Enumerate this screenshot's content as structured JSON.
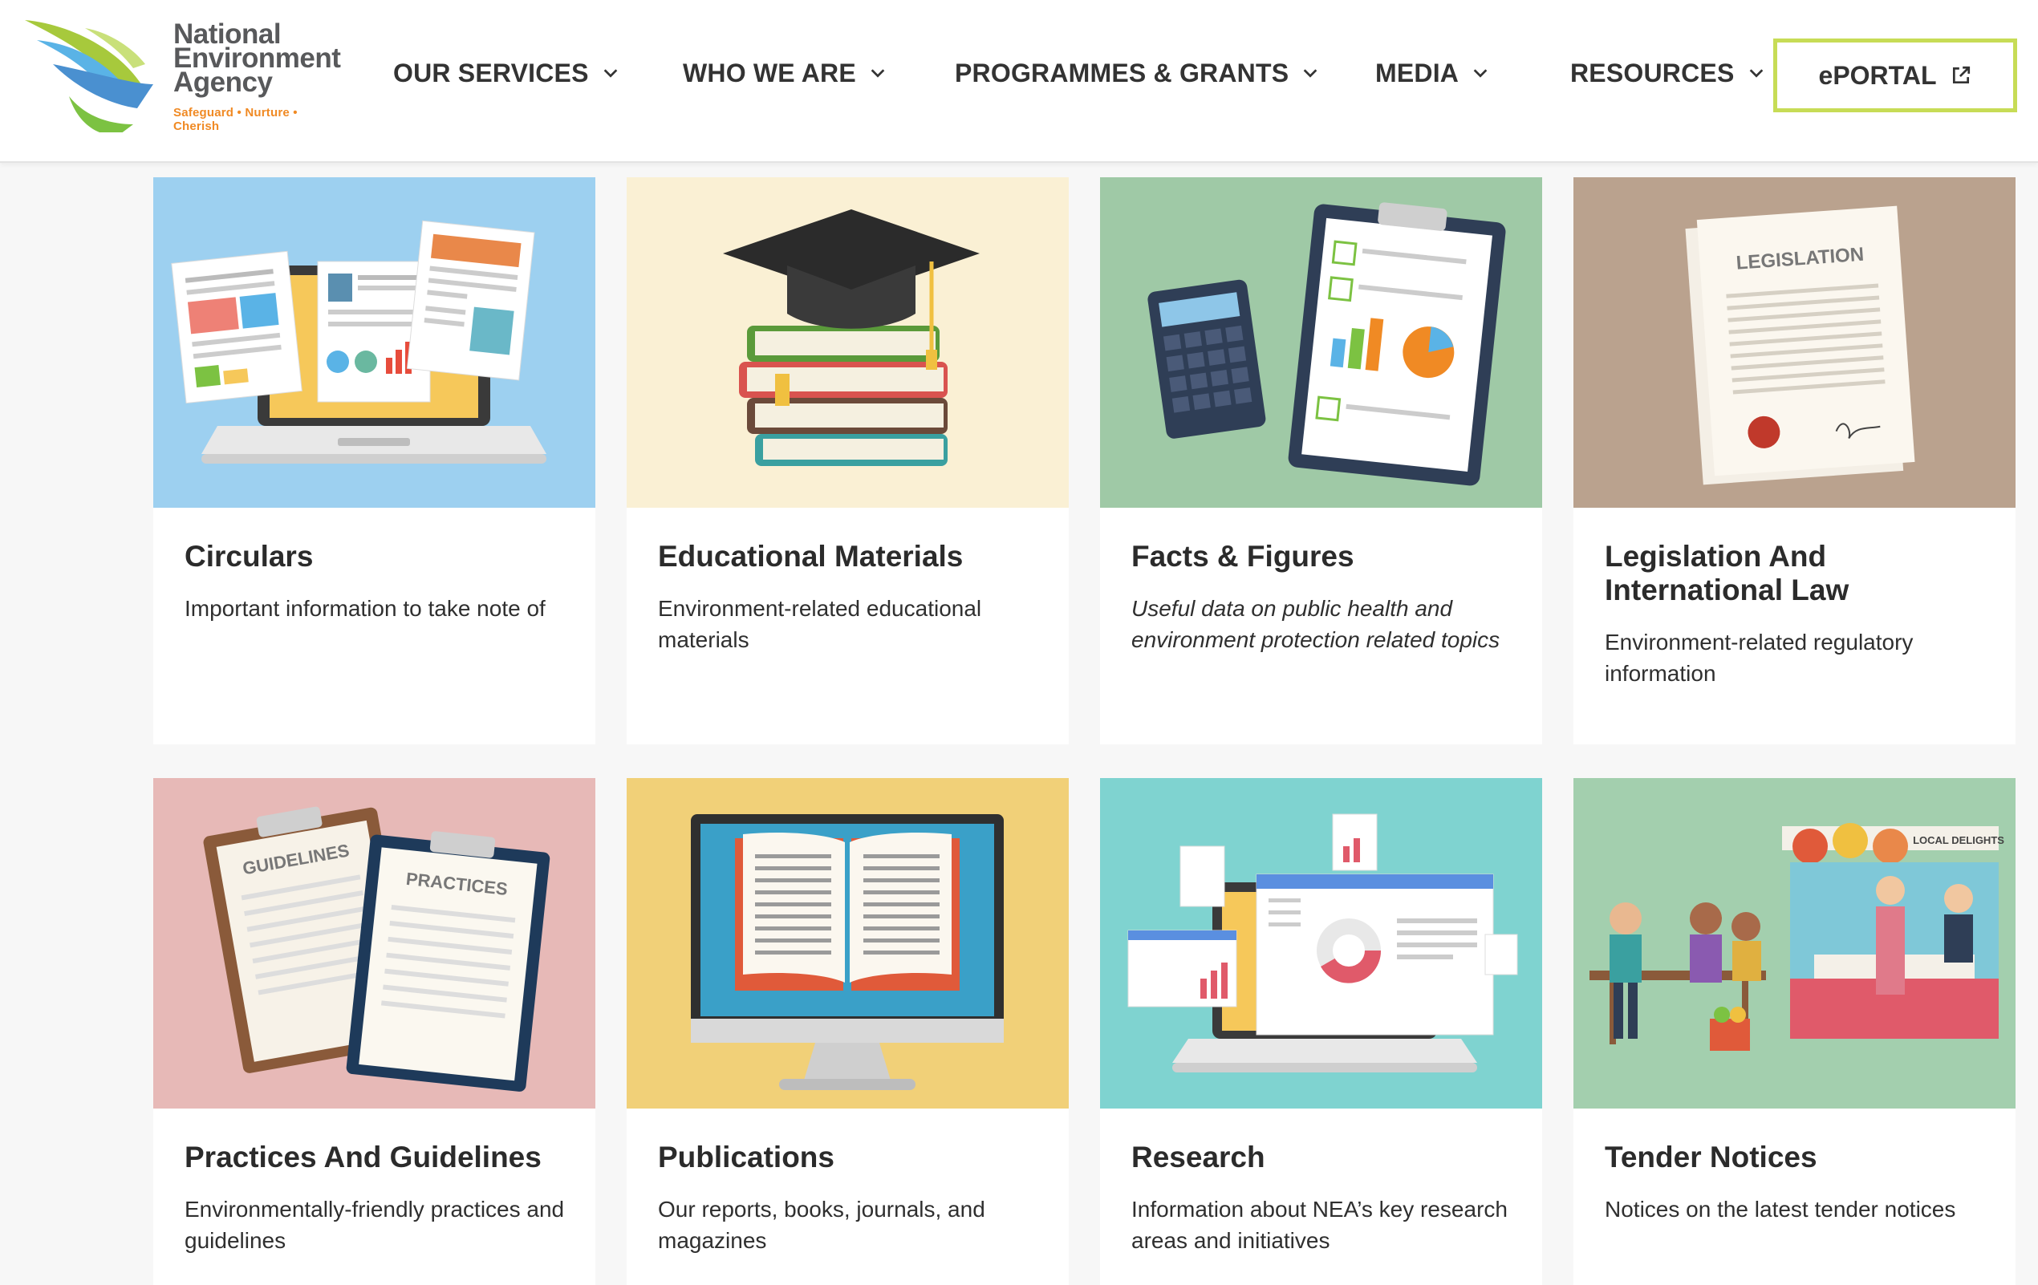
{
  "header": {
    "logo": {
      "line1": "National",
      "line2": "Environment",
      "line3": "Agency",
      "tagline": "Safeguard • Nurture • Cherish",
      "icon": "nea-swirl-logo"
    },
    "nav": [
      {
        "label": "OUR SERVICES",
        "icon": "chevron-down-icon"
      },
      {
        "label": "WHO WE ARE",
        "icon": "chevron-down-icon"
      },
      {
        "label": "PROGRAMMES & GRANTS",
        "icon": "chevron-down-icon"
      },
      {
        "label": "MEDIA",
        "icon": "chevron-down-icon"
      },
      {
        "label": "RESOURCES",
        "icon": "chevron-down-icon"
      }
    ],
    "eportal": {
      "label": "ePORTAL",
      "icon": "external-link-icon",
      "border_color": "#c7dc56"
    }
  },
  "cards": [
    {
      "title": "Circulars",
      "desc": "Important information to take note of",
      "bg": "#9dd0f0"
    },
    {
      "title": "Educational Materials",
      "desc": "Environment-related educational materials",
      "bg": "#faf0d4"
    },
    {
      "title": "Facts & Figures",
      "desc": "Useful data on public health and environment protection related topics",
      "bg": "#9fc9a6"
    },
    {
      "title": "Legislation And International Law",
      "desc": "Environment-related regulatory information",
      "bg": "#baa28e",
      "image_text": "LEGISLATION"
    },
    {
      "title": "Practices And Guidelines",
      "desc": "Environmentally-friendly practices and guidelines",
      "bg": "#e7b9b7",
      "image_text_1": "GUIDELINES",
      "image_text_2": "PRACTICES"
    },
    {
      "title": "Publications",
      "desc": "Our reports, books, journals, and magazines",
      "bg": "#f1d078"
    },
    {
      "title": "Research",
      "desc": "Information about NEA’s key research areas and initiatives",
      "bg": "#7fd3d0"
    },
    {
      "title": "Tender Notices",
      "desc": "Notices on the latest tender notices",
      "bg": "#a3cfae",
      "image_text": "LOCAL DELIGHTS"
    }
  ]
}
